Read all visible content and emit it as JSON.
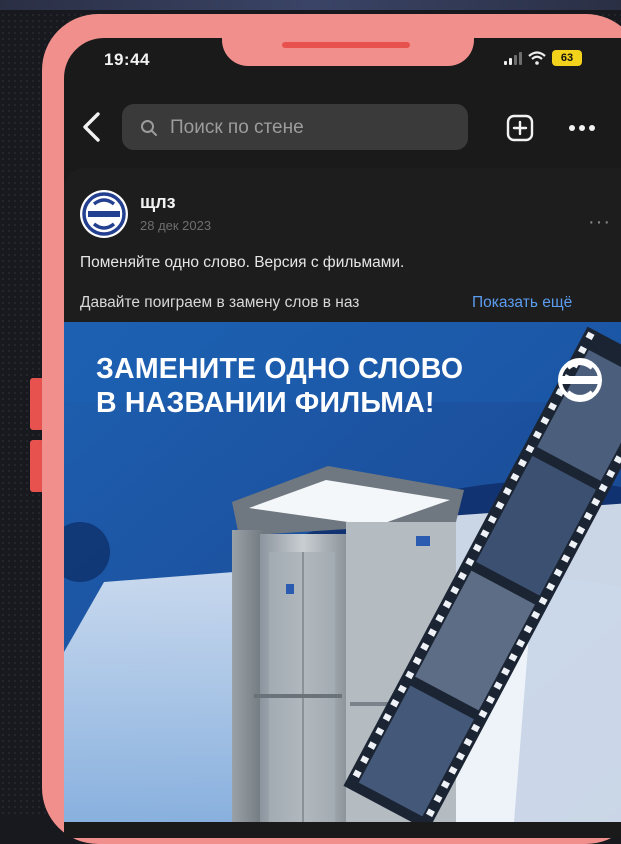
{
  "status_bar": {
    "time": "19:44",
    "battery": "63"
  },
  "search": {
    "placeholder": "Поиск по стене"
  },
  "post": {
    "author": "щлз",
    "date": "28 дек 2023",
    "text_line1": "Поменяйте одно слово. Версия с фильмами.",
    "text_line2": "Давайте поиграем в замену слов в наз",
    "show_more": "Показать ещё",
    "menu": "···"
  },
  "banner": {
    "title_line1": "ЗАМЕНИТЕ ОДНО СЛОВО",
    "title_line2": "В НАЗВАНИИ ФИЛЬМА!"
  },
  "colors": {
    "frame": "#f08f8c",
    "frame_accent": "#e8524e",
    "battery": "#f2d21a",
    "link": "#5b9cf0",
    "banner_blue": "#1e5fb0"
  },
  "icons": [
    "back-arrow-icon",
    "search-icon",
    "add-post-icon",
    "more-icon",
    "signal-icon",
    "wifi-icon",
    "battery-icon",
    "brand-logo-icon"
  ]
}
